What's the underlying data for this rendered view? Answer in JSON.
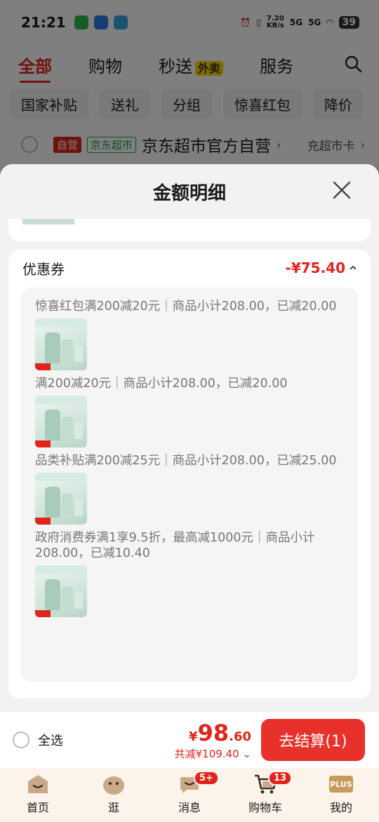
{
  "status_bar": {
    "time": "21:21",
    "net_speed": "7.20",
    "net_unit": "KB/s",
    "battery": "39",
    "sig1": "5G",
    "sig2": "5G"
  },
  "top_tabs": [
    {
      "label": "全部"
    },
    {
      "label": "购物"
    },
    {
      "label": "秒送",
      "badge": "外卖"
    },
    {
      "label": "服务"
    }
  ],
  "chips": [
    "国家补贴",
    "送礼",
    "分组",
    "惊喜红包",
    "降价"
  ],
  "store": {
    "tag_self": "自营",
    "tag_market": "京东超市",
    "name": "京东超市官方自营",
    "recharge": "充超市卡"
  },
  "sheet": {
    "title": "金额明细",
    "coupon_section": {
      "title": "优惠券",
      "amount": "-¥75.40",
      "items": [
        {
          "desc": "惊喜红包满200减20元｜商品小计208.00，已减20.00"
        },
        {
          "desc": "满200减20元｜商品小计208.00，已减20.00"
        },
        {
          "desc": "品类补贴满200减25元｜商品小计208.00，已减25.00"
        },
        {
          "desc": "政府消费券满1享9.5折，最高减1000元｜商品小计208.00，已减10.40"
        }
      ]
    }
  },
  "checkout": {
    "select_all": "全选",
    "price_yen": "¥",
    "price_int": "98",
    "price_dec": ".60",
    "discount": "共减¥109.40",
    "button": "去结算(1)"
  },
  "bottom_nav": [
    {
      "label": "首页",
      "badge": ""
    },
    {
      "label": "逛",
      "badge": ""
    },
    {
      "label": "消息",
      "badge": "5+"
    },
    {
      "label": "购物车",
      "badge": "13"
    },
    {
      "label": "我的",
      "badge": "",
      "icon_text": "PLUS"
    }
  ],
  "colors": {
    "accent": "#e2231a",
    "nav_bg": "#fcf3ea",
    "plus_gold": "#c99a5a"
  }
}
